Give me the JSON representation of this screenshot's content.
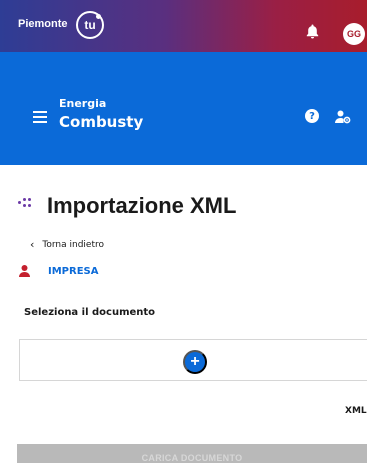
{
  "header": {
    "brand": "Piemonte",
    "logo_text": "tu",
    "bell_icon": "bell-icon",
    "user_initials": "GG"
  },
  "appbar": {
    "menu_icon": "hamburger-menu-icon",
    "subtitle": "Energia",
    "title": "Combusty",
    "help_icon": "question-circle-icon",
    "settings_icon": "user-cog-icon"
  },
  "page": {
    "title": "Importazione XML",
    "back_label": "Torna indietro",
    "section_label": "IMPRESA",
    "select_document_label": "Seleziona il documento",
    "add_icon": "plus-circle-icon",
    "file_type_label": "XML",
    "upload_button": "CARICA DOCUMENTO"
  },
  "colors": {
    "primary": "#0b6ad8",
    "accent_red": "#a81d2c",
    "accent_purple": "#6b3aa6",
    "disabled": "#b9b9b9"
  }
}
